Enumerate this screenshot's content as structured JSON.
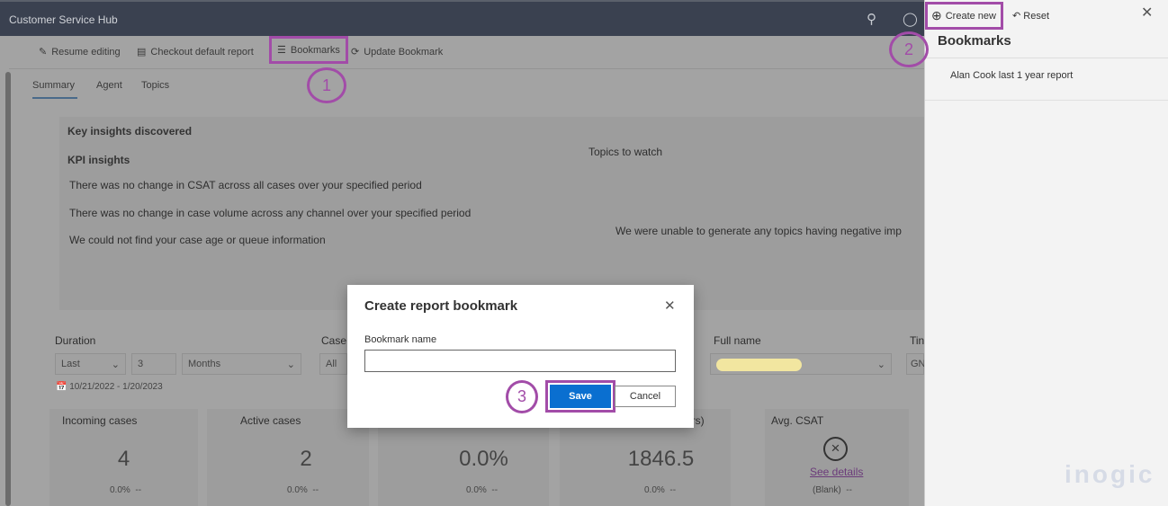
{
  "header": {
    "title": "Customer Service Hub",
    "icons": [
      "search-icon",
      "lightbulb-icon"
    ]
  },
  "toolbar": {
    "resume": "Resume editing",
    "checkout": "Checkout default report",
    "bookmarks": "Bookmarks",
    "update": "Update Bookmark"
  },
  "tabs": [
    "Summary",
    "Agent",
    "Topics"
  ],
  "insights": {
    "heading": "Key insights discovered",
    "kpi": "KPI insights",
    "lines": [
      "There was no change in CSAT across all cases over your specified period",
      "There was no change in case volume across any channel over your specified period",
      "We could not find your case age or queue information"
    ],
    "topics_title": "Topics to watch",
    "topics_msg": "We were unable to generate any topics having negative imp"
  },
  "filters": {
    "duration_label": "Duration",
    "duration_mode": "Last",
    "duration_value": "3",
    "duration_unit": "Months",
    "case_label": "Case",
    "case_value": "All",
    "fullname_label": "Full name",
    "tz_label": "Tin",
    "tz_value": "GN",
    "date_range": "10/21/2022 - 1/20/2023"
  },
  "metrics": [
    {
      "title": "Incoming cases",
      "value": "4",
      "change": "0.0%",
      "trend": "--"
    },
    {
      "title": "Active cases",
      "value": "2",
      "change": "0.0%",
      "trend": "--"
    },
    {
      "title": "",
      "value": "0.0%",
      "change": "0.0%",
      "trend": "--"
    },
    {
      "title": "hrs)",
      "value": "1846.5",
      "change": "0.0%",
      "trend": "--"
    },
    {
      "title": "Avg. CSAT",
      "link": "See details",
      "change": "(Blank)",
      "trend": "--"
    }
  ],
  "panel": {
    "create_new": "Create new",
    "reset": "Reset",
    "title": "Bookmarks",
    "items": [
      "Alan Cook last 1 year report"
    ]
  },
  "dialog": {
    "title": "Create report bookmark",
    "field_label": "Bookmark name",
    "field_value": "",
    "save": "Save",
    "cancel": "Cancel"
  },
  "annotations": {
    "step1": "1",
    "step2": "2",
    "step3": "3",
    "highlight_color": "#a24ca8"
  },
  "watermark": "inogic"
}
